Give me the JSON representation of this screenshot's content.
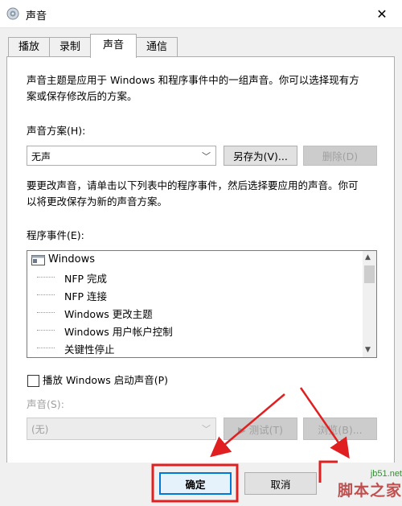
{
  "window": {
    "title": "声音",
    "close_glyph": "✕"
  },
  "tabs": [
    {
      "label": "播放"
    },
    {
      "label": "录制"
    },
    {
      "label": "声音"
    },
    {
      "label": "通信"
    }
  ],
  "description": {
    "line1": "声音主题是应用于 Windows 和程序事件中的一组声音。你可以选择现有方",
    "line2": "案或保存修改后的方案。"
  },
  "scheme": {
    "label": "声音方案(H):",
    "value": "无声",
    "save_as_label": "另存为(V)...",
    "delete_label": "删除(D)"
  },
  "instructions": {
    "line1": "要更改声音，请单击以下列表中的程序事件，然后选择要应用的声音。你可",
    "line2": "以将更改保存为新的声音方案。"
  },
  "events": {
    "label": "程序事件(E):",
    "root": "Windows",
    "items": [
      "NFP 完成",
      "NFP 连接",
      "Windows 更改主题",
      "Windows 用户帐户控制",
      "关键性停止"
    ]
  },
  "startup_sound": {
    "label": "播放 Windows 启动声音(P)"
  },
  "sound": {
    "label": "声音(S):",
    "value": "(无)",
    "test_label": "▶ 测试(T)",
    "browse_label": "浏览(B)..."
  },
  "footer": {
    "ok_label": "确定",
    "cancel_label": "取消"
  },
  "watermark": {
    "site": "jb51.net",
    "name": "脚本之家"
  },
  "colors": {
    "annotation_red": "#e02020"
  }
}
